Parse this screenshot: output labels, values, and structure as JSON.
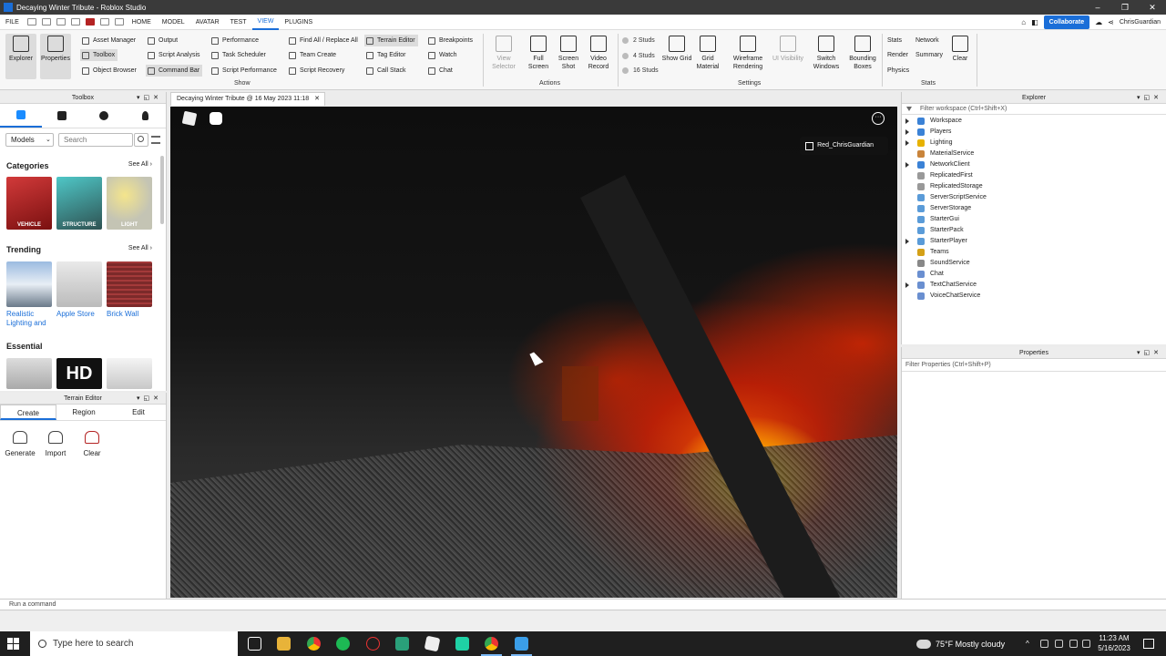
{
  "window": {
    "title": "Decaying Winter Tribute - Roblox Studio"
  },
  "menu": {
    "file": "FILE",
    "tabs": [
      "HOME",
      "MODEL",
      "AVATAR",
      "TEST",
      "VIEW",
      "PLUGINS"
    ],
    "active_tab": "VIEW",
    "collaborate": "Collaborate",
    "username": "ChrisGuardian"
  },
  "ribbon": {
    "explorer": "Explorer",
    "properties": "Properties",
    "show_items": [
      "Asset Manager",
      "Toolbox",
      "Object Browser",
      "Output",
      "Script Analysis",
      "Command Bar",
      "Performance",
      "Task Scheduler",
      "Script Performance",
      "Find All / Replace All",
      "Team Create",
      "Script Recovery",
      "Terrain Editor",
      "Tag Editor",
      "Call Stack",
      "Breakpoints",
      "Watch",
      "Chat"
    ],
    "show_group": "Show",
    "actions": [
      "View Selector",
      "Full Screen",
      "Screen Shot",
      "Video Record"
    ],
    "actions_group": "Actions",
    "studs": [
      "2 Studs",
      "4 Studs",
      "16 Studs"
    ],
    "settings": [
      "Show Grid",
      "Grid Material",
      "Wireframe Rendering",
      "UI Visibility",
      "Switch Windows",
      "Bounding Boxes"
    ],
    "settings_group": "Settings",
    "stats": [
      "Stats",
      "Render",
      "Physics",
      "Network",
      "Summary"
    ],
    "clear": "Clear",
    "stats_group": "Stats"
  },
  "toolbox": {
    "title": "Toolbox",
    "category_select": "Models",
    "search_placeholder": "Search",
    "categories_title": "Categories",
    "see_all": "See All",
    "categories": [
      "VEHICLE",
      "STRUCTURE",
      "LIGHT"
    ],
    "trending_title": "Trending",
    "trending": [
      "Realistic Lighting and",
      "Apple Store",
      "Brick Wall"
    ],
    "essential_title": "Essential",
    "essential_hd": "HD"
  },
  "terrain": {
    "title": "Terrain Editor",
    "tabs": [
      "Create",
      "Region",
      "Edit"
    ],
    "tools": [
      "Generate",
      "Import",
      "Clear"
    ]
  },
  "document": {
    "tab": "Decaying Winter Tribute @ 16 May 2023 11:18",
    "player_name": "Red_ChrisGuardian"
  },
  "explorer": {
    "title": "Explorer",
    "filter": "Filter workspace (Ctrl+Shift+X)",
    "items": [
      "Workspace",
      "Players",
      "Lighting",
      "MaterialService",
      "NetworkClient",
      "ReplicatedFirst",
      "ReplicatedStorage",
      "ServerScriptService",
      "ServerStorage",
      "StarterGui",
      "StarterPack",
      "StarterPlayer",
      "Teams",
      "SoundService",
      "Chat",
      "TextChatService",
      "VoiceChatService"
    ]
  },
  "properties": {
    "title": "Properties",
    "filter": "Filter Properties (Ctrl+Shift+P)"
  },
  "command_bar": {
    "placeholder": "Run a command"
  },
  "taskbar": {
    "search": "Type here to search",
    "weather": "75°F  Mostly cloudy",
    "time": "11:23 AM",
    "date": "5/16/2023"
  }
}
